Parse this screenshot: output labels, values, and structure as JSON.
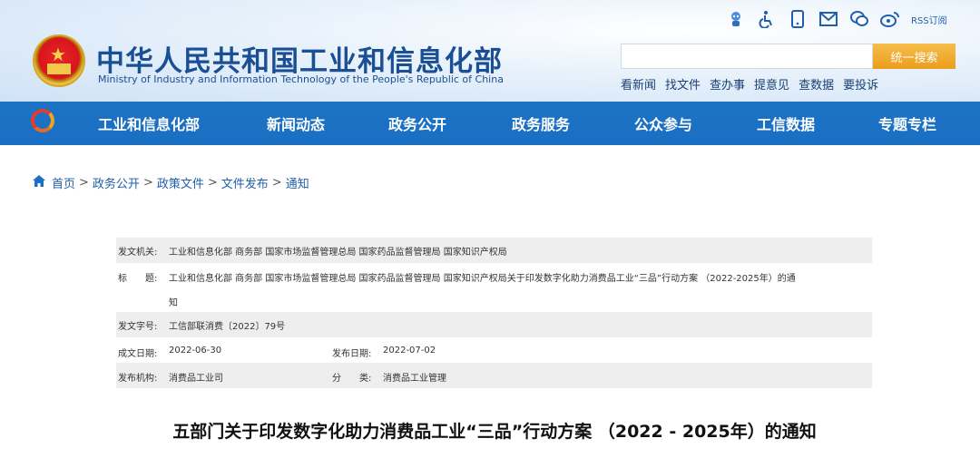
{
  "header": {
    "title": "中华人民共和国工业和信息化部",
    "subtitle": "Ministry of Industry and Information Technology of the People's Republic of China",
    "top_icons": [
      "robot-icon",
      "accessibility-icon",
      "mobile-icon",
      "mail-icon",
      "wechat-icon",
      "weibo-icon"
    ],
    "rss_label": "RSS订阅",
    "search": {
      "placeholder": "",
      "button_label": "统一搜索"
    },
    "quick_links": [
      "看新闻",
      "找文件",
      "查办事",
      "提意见",
      "查数据",
      "要投诉"
    ]
  },
  "nav": {
    "items": [
      "工业和信息化部",
      "新闻动态",
      "政务公开",
      "政务服务",
      "公众参与",
      "工信数据",
      "专题专栏"
    ]
  },
  "breadcrumb": [
    "首页",
    "政务公开",
    "政策文件",
    "文件发布",
    "通知"
  ],
  "meta": {
    "issuer_label": "发文机关:",
    "issuer": "工业和信息化部 商务部 国家市场监督管理总局 国家药品监督管理局 国家知识产权局",
    "title_label": "标　　题:",
    "title_line1": "工业和信息化部 商务部 国家市场监督管理总局 国家药品监督管理局 国家知识产权局关于印发数字化助力消费品工业“三品”行动方案 （2022-2025年）的通",
    "title_line2": "知",
    "doc_no_label": "发文字号:",
    "doc_no": "工信部联消费〔2022〕79号",
    "date_written_label": "成文日期:",
    "date_written": "2022-06-30",
    "date_published_label": "发布日期:",
    "date_published": "2022-07-02",
    "agency_label": "发布机构:",
    "agency": "消费品工业司",
    "category_label": "分　　类:",
    "category": "消费品工业管理"
  },
  "document": {
    "title": "五部门关于印发数字化助力消费品工业“三品”行动方案 （2022 - 2025年）的通知"
  }
}
